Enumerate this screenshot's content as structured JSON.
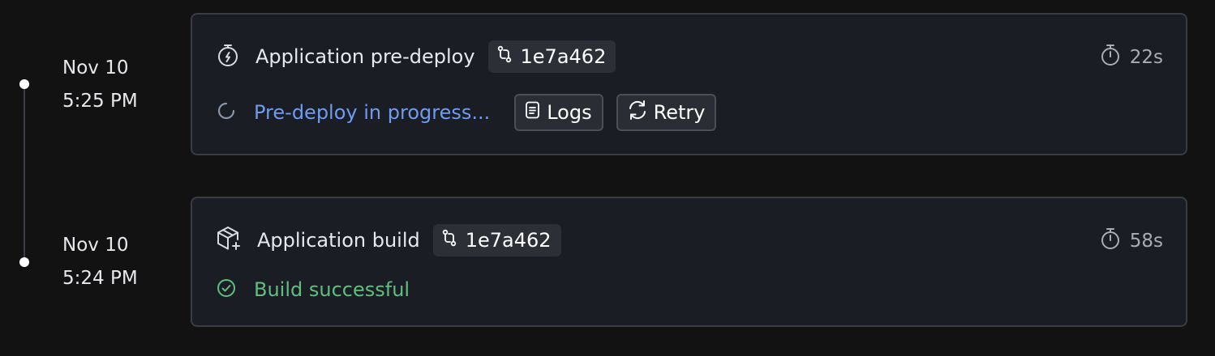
{
  "timeline": [
    {
      "date": "Nov 10",
      "time": "5:25 PM",
      "title": "Application pre-deploy",
      "title_icon": "timer-icon",
      "commit": "1e7a462",
      "duration": "22s",
      "status": "Pre-deploy in progress...",
      "status_icon": "spinner-icon",
      "status_color": "#6e9cf0",
      "buttons": {
        "logs": "Logs",
        "retry": "Retry"
      }
    },
    {
      "date": "Nov 10",
      "time": "5:24 PM",
      "title": "Application build",
      "title_icon": "package-icon",
      "commit": "1e7a462",
      "duration": "58s",
      "status": "Build successful",
      "status_icon": "check-circle-icon",
      "status_color": "#5fbf7e"
    }
  ]
}
